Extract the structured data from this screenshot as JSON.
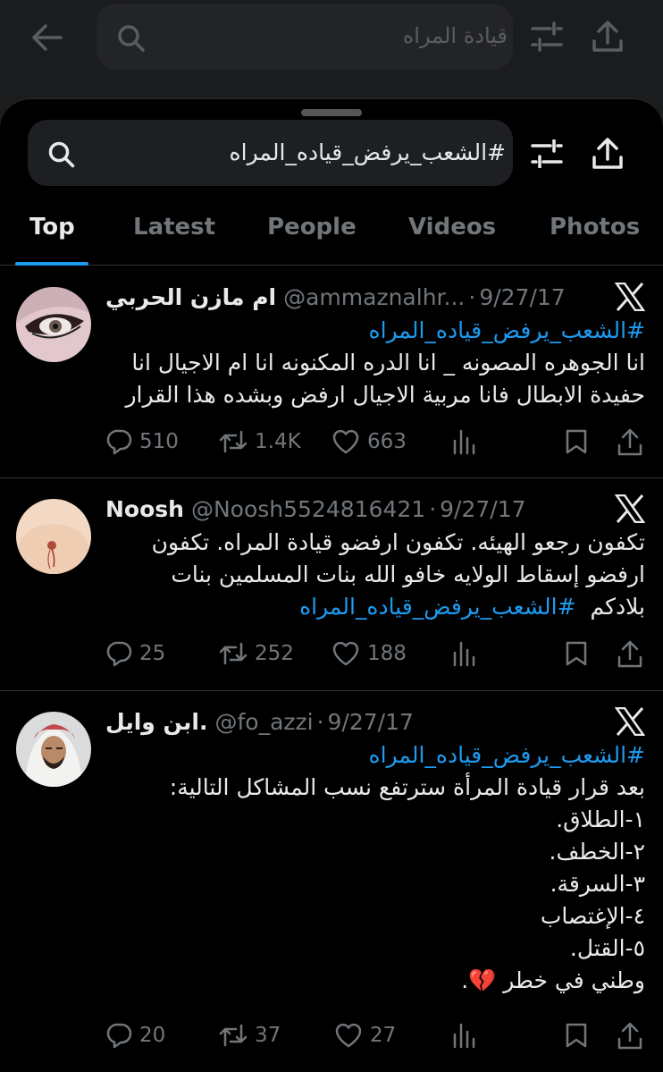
{
  "background": {
    "search_query": "قيادة المراه",
    "icons": [
      "back-arrow-icon",
      "search-icon",
      "filter-icon",
      "share-icon"
    ]
  },
  "search": {
    "query": "#الشعب_يرفض_قياده_المراه"
  },
  "tabs": [
    {
      "label": "Top",
      "active": true
    },
    {
      "label": "Latest",
      "active": false
    },
    {
      "label": "People",
      "active": false
    },
    {
      "label": "Videos",
      "active": false
    },
    {
      "label": "Photos",
      "active": false
    }
  ],
  "tweets": [
    {
      "name": "ام مازن الحربي",
      "handle": "@ammaznalhr...",
      "date": "9/27/17",
      "lines": [
        {
          "text": "#الشعب_يرفض_قياده_المراه",
          "hashtag": true
        },
        {
          "text": "انا الجوهره المصونه _ انا الدره المكنونه انا ام الاجيال انا",
          "hashtag": false
        },
        {
          "text": "حفيدة الابطال فانا مربية الاجيال ارفض وبشده هذا القرار",
          "hashtag": false
        }
      ],
      "replies": "510",
      "reposts": "1.4K",
      "likes": "663"
    },
    {
      "name": "Noosh",
      "handle": "@Noosh5524816421",
      "date": "9/27/17",
      "lines": [
        {
          "text": "تكفون رجعو الهيئه. تكفون ارفضو قيادة المراه. تكفون",
          "hashtag": false
        },
        {
          "text": "ارفضو إسقاط الولايه خافو الله بنات المسلمين بنات",
          "hashtag": false
        },
        {
          "text": "بلادكم",
          "hashtag": false,
          "trailing_hashtag": "#الشعب_يرفض_قياده_المراه"
        }
      ],
      "replies": "25",
      "reposts": "252",
      "likes": "188"
    },
    {
      "name": "ابن وايل.",
      "handle": "@fo_azzi",
      "date": "9/27/17",
      "lines": [
        {
          "text": "#الشعب_يرفض_قياده_المراه",
          "hashtag": true
        },
        {
          "text": "بعد قرار قيادة المرأة سترتفع نسب المشاكل التالية:",
          "hashtag": false
        },
        {
          "text": "١-الطلاق.",
          "hashtag": false
        },
        {
          "text": "٢-الخطف.",
          "hashtag": false
        },
        {
          "text": "٣-السرقة.",
          "hashtag": false
        },
        {
          "text": "٤-الإغتصاب",
          "hashtag": false
        },
        {
          "text": "٥-القتل.",
          "hashtag": false
        },
        {
          "text": "وطني في خطر 💔.",
          "hashtag": false
        }
      ],
      "replies": "20",
      "reposts": "37",
      "likes": "27"
    }
  ],
  "colors": {
    "accent": "#1d9bf0",
    "secondary_text": "#71767b",
    "primary_text": "#e7e9ea",
    "background": "#000000"
  }
}
